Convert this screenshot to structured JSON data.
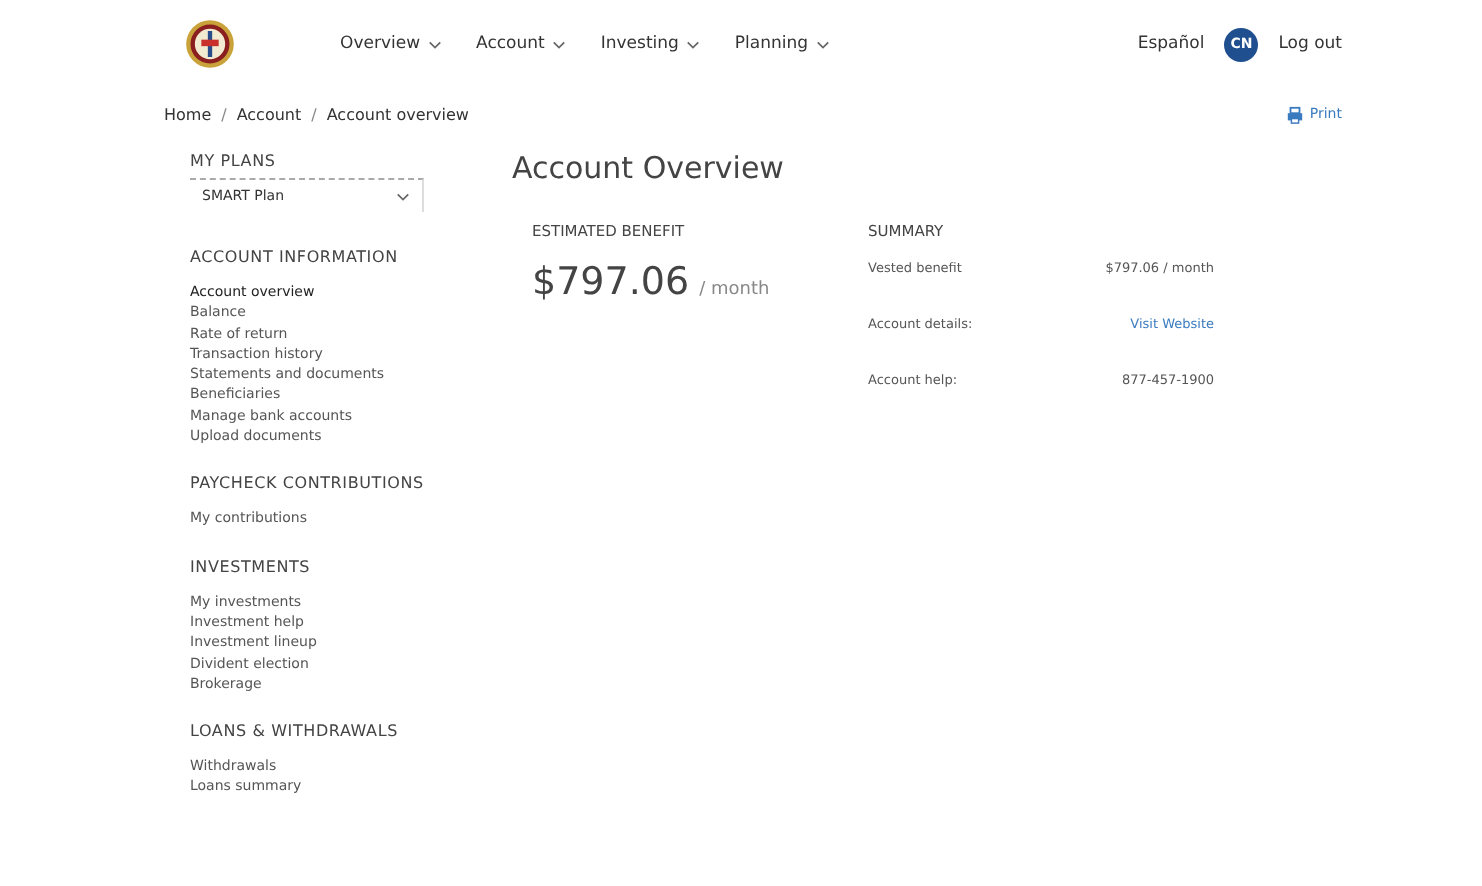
{
  "nav": {
    "items": [
      {
        "label": "Overview"
      },
      {
        "label": "Account"
      },
      {
        "label": "Investing"
      },
      {
        "label": "Planning"
      }
    ],
    "language": "Español",
    "avatar": "CN",
    "logout": "Log out"
  },
  "breadcrumb": [
    {
      "label": "Home"
    },
    {
      "separator": "/",
      "label": "Account"
    },
    {
      "separator": "/",
      "label": "Account overview"
    }
  ],
  "print": "Print",
  "sidebar": {
    "plans_title": "MY PLANS",
    "plan_select": "SMART Plan",
    "sections": [
      {
        "title": "ACCOUNT INFORMATION",
        "items": [
          {
            "label": "Account overview",
            "selected": true
          },
          {
            "label": "Balance",
            "selected": false
          },
          {
            "label": "Rate of return",
            "selected": false
          },
          {
            "label": "Transaction history",
            "selected": false
          },
          {
            "label": "Statements and documents",
            "selected": false
          },
          {
            "label": "Beneficiaries",
            "selected": false
          },
          {
            "label": "Manage bank accounts",
            "selected": false
          },
          {
            "label": "Upload documents",
            "selected": false
          }
        ]
      },
      {
        "title": "PAYCHECK CONTRIBUTIONS",
        "items": [
          {
            "label": "My contributions",
            "selected": false
          }
        ]
      },
      {
        "title": "INVESTMENTS",
        "items": [
          {
            "label": "My investments",
            "selected": false
          },
          {
            "label": "Investment help",
            "selected": false
          },
          {
            "label": "Investment lineup",
            "selected": false
          },
          {
            "label": "Divident election",
            "selected": false
          },
          {
            "label": "Brokerage",
            "selected": false
          }
        ]
      },
      {
        "title": "LOANS & WITHDRAWALS",
        "items": [
          {
            "label": "Withdrawals",
            "selected": false
          },
          {
            "label": "Loans summary",
            "selected": false
          }
        ]
      }
    ]
  },
  "main": {
    "title": "Account Overview",
    "benefit_title": "ESTIMATED BENEFIT",
    "benefit_amount": "$797.06",
    "benefit_unit": "/ month",
    "summary_title": "SUMMARY",
    "summary_rows": [
      {
        "label": "Vested benefit",
        "value": "$797.06 / month",
        "kind": "text"
      },
      {
        "label": "Account details:",
        "value": "Visit Website",
        "kind": "link"
      },
      {
        "label": "Account help:",
        "value": "877-457-1900",
        "kind": "text"
      }
    ]
  }
}
